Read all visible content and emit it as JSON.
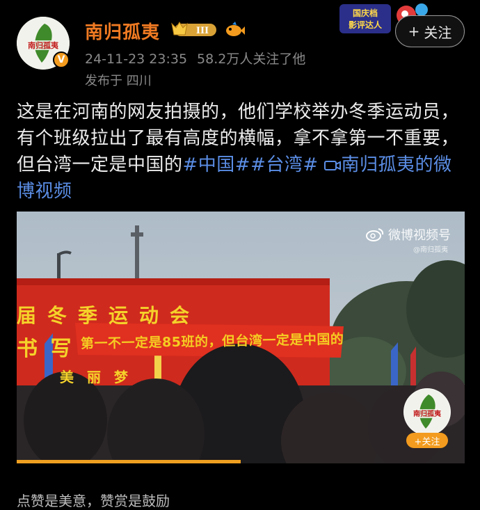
{
  "author": {
    "name": "南归孤夷",
    "level": "III",
    "avatar_text": "南归孤夷",
    "verified_mark": "V"
  },
  "post_meta": {
    "datetime": "24-11-23 23:35",
    "followers": "58.2万人关注了他",
    "published_from": "发布于 四川"
  },
  "promo": {
    "line1": "国庆档",
    "line2": "影评达人"
  },
  "follow_button": {
    "label": "关注",
    "icon": "plus-icon"
  },
  "post": {
    "text_main": "这是在河南的网友拍摄的，他们学校举办冬季运动员，有个班级拉出了最有高度的横幅，拿不拿第一不重要，但台湾一定是中国的",
    "hashtag1": "#中国#",
    "hashtag2": "#台湾#",
    "video_link": "南归孤夷的微博视频",
    "video_link_icon": "video-icon"
  },
  "video": {
    "watermark_main": "微博视频号",
    "watermark_sub": "@南归孤夷",
    "stage_banner": "届冬季运动会",
    "stage_left": "书 写",
    "stage_left2": "美 丽 梦",
    "held_banner": "第一不一定是85班的，但台湾一定是中国的",
    "overlay_avatar_text": "南归孤夷",
    "overlay_follow_label": "+关注",
    "progress_fraction": 0.5
  },
  "footer": {
    "text": "点赞是美意，赞赏是鼓励"
  },
  "colors": {
    "accent_orange": "#f07a22",
    "link_blue": "#5b8ee6",
    "banner_red": "#d6241c",
    "banner_yellow": "#f5cc22"
  }
}
